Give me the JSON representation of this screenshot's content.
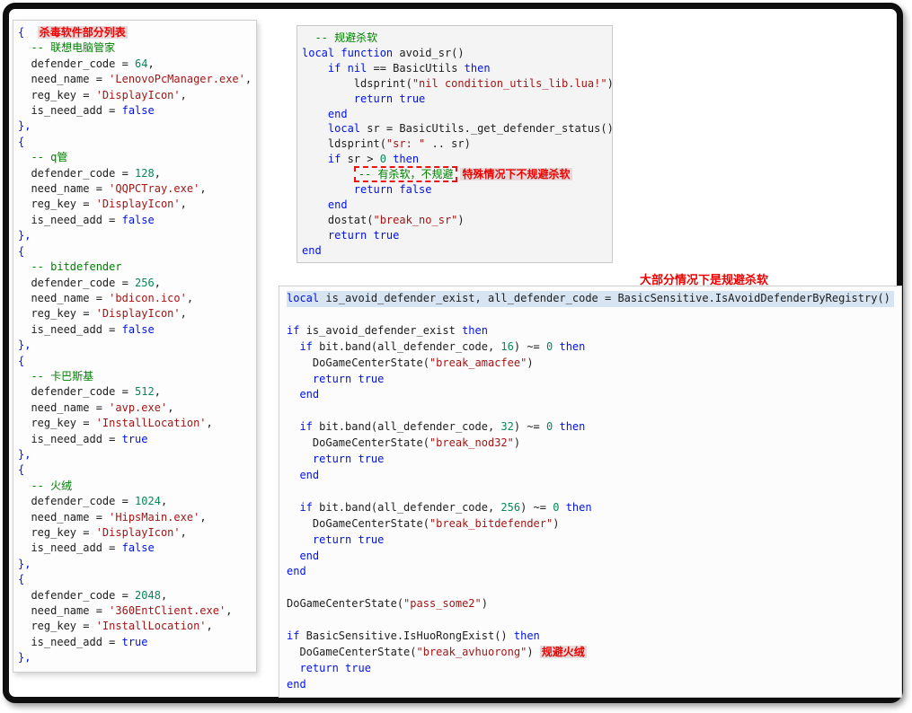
{
  "annotations": {
    "mid_note": "大部分情况下是规避杀软"
  },
  "panels": {
    "left": {
      "sel_lines": [],
      "lines": [
        [
          [
            "k",
            "{"
          ],
          [
            "p",
            "  "
          ],
          [
            "ah",
            "杀毒软件部分列表"
          ]
        ],
        [
          [
            "c",
            "  -- 联想电脑管家"
          ]
        ],
        [
          [
            "p",
            "  defender_code = "
          ],
          [
            "n",
            "64"
          ],
          [
            "p",
            ","
          ]
        ],
        [
          [
            "p",
            "  need_name = "
          ],
          [
            "s",
            "'LenovoPcManager.exe'"
          ],
          [
            "p",
            ","
          ]
        ],
        [
          [
            "p",
            "  reg_key = "
          ],
          [
            "s",
            "'DisplayIcon'"
          ],
          [
            "p",
            ","
          ]
        ],
        [
          [
            "p",
            "  is_need_add = "
          ],
          [
            "k",
            "false"
          ]
        ],
        [
          [
            "k",
            "},"
          ]
        ],
        [
          [
            "k",
            "{"
          ]
        ],
        [
          [
            "c",
            "  -- q管"
          ]
        ],
        [
          [
            "p",
            "  defender_code = "
          ],
          [
            "n",
            "128"
          ],
          [
            "p",
            ","
          ]
        ],
        [
          [
            "p",
            "  need_name = "
          ],
          [
            "s",
            "'QQPCTray.exe'"
          ],
          [
            "p",
            ","
          ]
        ],
        [
          [
            "p",
            "  reg_key = "
          ],
          [
            "s",
            "'DisplayIcon'"
          ],
          [
            "p",
            ","
          ]
        ],
        [
          [
            "p",
            "  is_need_add = "
          ],
          [
            "k",
            "false"
          ]
        ],
        [
          [
            "k",
            "},"
          ]
        ],
        [
          [
            "k",
            "{"
          ]
        ],
        [
          [
            "c",
            "  -- bitdefender"
          ]
        ],
        [
          [
            "p",
            "  defender_code = "
          ],
          [
            "n",
            "256"
          ],
          [
            "p",
            ","
          ]
        ],
        [
          [
            "p",
            "  need_name = "
          ],
          [
            "s",
            "'bdicon.ico'"
          ],
          [
            "p",
            ","
          ]
        ],
        [
          [
            "p",
            "  reg_key = "
          ],
          [
            "s",
            "'DisplayIcon'"
          ],
          [
            "p",
            ","
          ]
        ],
        [
          [
            "p",
            "  is_need_add = "
          ],
          [
            "k",
            "false"
          ]
        ],
        [
          [
            "k",
            "},"
          ]
        ],
        [
          [
            "k",
            "{"
          ]
        ],
        [
          [
            "c",
            "  -- 卡巴斯基"
          ]
        ],
        [
          [
            "p",
            "  defender_code = "
          ],
          [
            "n",
            "512"
          ],
          [
            "p",
            ","
          ]
        ],
        [
          [
            "p",
            "  need_name = "
          ],
          [
            "s",
            "'avp.exe'"
          ],
          [
            "p",
            ","
          ]
        ],
        [
          [
            "p",
            "  reg_key = "
          ],
          [
            "s",
            "'InstallLocation'"
          ],
          [
            "p",
            ","
          ]
        ],
        [
          [
            "p",
            "  is_need_add = "
          ],
          [
            "k",
            "true"
          ]
        ],
        [
          [
            "k",
            "},"
          ]
        ],
        [
          [
            "k",
            "{"
          ]
        ],
        [
          [
            "c",
            "  -- 火绒"
          ]
        ],
        [
          [
            "p",
            "  defender_code = "
          ],
          [
            "n",
            "1024"
          ],
          [
            "p",
            ","
          ]
        ],
        [
          [
            "p",
            "  need_name = "
          ],
          [
            "s",
            "'HipsMain.exe'"
          ],
          [
            "p",
            ","
          ]
        ],
        [
          [
            "p",
            "  reg_key = "
          ],
          [
            "s",
            "'DisplayIcon'"
          ],
          [
            "p",
            ","
          ]
        ],
        [
          [
            "p",
            "  is_need_add = "
          ],
          [
            "k",
            "false"
          ]
        ],
        [
          [
            "k",
            "},"
          ]
        ],
        [
          [
            "k",
            "{"
          ]
        ],
        [
          [
            "p",
            "  defender_code = "
          ],
          [
            "n",
            "2048"
          ],
          [
            "p",
            ","
          ]
        ],
        [
          [
            "p",
            "  need_name = "
          ],
          [
            "s",
            "'360EntClient.exe'"
          ],
          [
            "p",
            ","
          ]
        ],
        [
          [
            "p",
            "  reg_key = "
          ],
          [
            "s",
            "'InstallLocation'"
          ],
          [
            "p",
            ","
          ]
        ],
        [
          [
            "p",
            "  is_need_add = "
          ],
          [
            "k",
            "true"
          ]
        ],
        [
          [
            "k",
            "},"
          ]
        ]
      ]
    },
    "top_right": {
      "sel_lines": [],
      "lines": [
        [
          [
            "c",
            "  -- 规避杀软"
          ]
        ],
        [
          [
            "k",
            "local function"
          ],
          [
            "p",
            " avoid_sr()"
          ]
        ],
        [
          [
            "p",
            "    "
          ],
          [
            "k",
            "if"
          ],
          [
            "p",
            " "
          ],
          [
            "k",
            "nil"
          ],
          [
            "p",
            " == BasicUtils "
          ],
          [
            "k",
            "then"
          ]
        ],
        [
          [
            "p",
            "        ldsprint("
          ],
          [
            "s",
            "\"nil condition_utils_lib.lua!\""
          ],
          [
            "p",
            ")"
          ]
        ],
        [
          [
            "p",
            "        "
          ],
          [
            "k",
            "return true"
          ]
        ],
        [
          [
            "p",
            "    "
          ],
          [
            "k",
            "end"
          ]
        ],
        [
          [
            "p",
            "    "
          ],
          [
            "k",
            "local"
          ],
          [
            "p",
            " sr = BasicUtils._get_defender_status()"
          ]
        ],
        [
          [
            "p",
            "    ldsprint("
          ],
          [
            "s",
            "\"sr: \""
          ],
          [
            "p",
            " .. sr)"
          ]
        ],
        [
          [
            "p",
            "    "
          ],
          [
            "k",
            "if"
          ],
          [
            "p",
            " sr > "
          ],
          [
            "n",
            "0"
          ],
          [
            "p",
            " "
          ],
          [
            "k",
            "then"
          ]
        ],
        [
          [
            "p",
            "        "
          ],
          [
            "bx",
            "-- 有杀软，不规避"
          ],
          [
            "ah",
            "特殊情况下不规避杀软"
          ]
        ],
        [
          [
            "p",
            "        "
          ],
          [
            "k",
            "return false"
          ]
        ],
        [
          [
            "p",
            "    "
          ],
          [
            "k",
            "end"
          ]
        ],
        [
          [
            "p",
            "    dostat("
          ],
          [
            "s",
            "\"break_no_sr\""
          ],
          [
            "p",
            ")"
          ]
        ],
        [
          [
            "p",
            "    "
          ],
          [
            "k",
            "return true"
          ]
        ],
        [
          [
            "k",
            "end"
          ]
        ]
      ]
    },
    "bottom_right": {
      "sel_lines": [
        0
      ],
      "lines": [
        [
          [
            "k",
            "local"
          ],
          [
            "p",
            " is_avoid_defender_exist, all_defender_code = BasicSensitive.IsAvoidDefenderByRegistry()"
          ]
        ],
        [],
        [
          [
            "k",
            "if"
          ],
          [
            "p",
            " is_avoid_defender_exist "
          ],
          [
            "k",
            "then"
          ]
        ],
        [
          [
            "p",
            "  "
          ],
          [
            "k",
            "if"
          ],
          [
            "p",
            " bit.band(all_defender_code, "
          ],
          [
            "n",
            "16"
          ],
          [
            "p",
            ") ~= "
          ],
          [
            "n",
            "0"
          ],
          [
            "p",
            " "
          ],
          [
            "k",
            "then"
          ]
        ],
        [
          [
            "p",
            "    DoGameCenterState("
          ],
          [
            "s",
            "\"break_amacfee\""
          ],
          [
            "p",
            ")"
          ]
        ],
        [
          [
            "p",
            "    "
          ],
          [
            "k",
            "return true"
          ]
        ],
        [
          [
            "p",
            "  "
          ],
          [
            "k",
            "end"
          ]
        ],
        [],
        [
          [
            "p",
            "  "
          ],
          [
            "k",
            "if"
          ],
          [
            "p",
            " bit.band(all_defender_code, "
          ],
          [
            "n",
            "32"
          ],
          [
            "p",
            ") ~= "
          ],
          [
            "n",
            "0"
          ],
          [
            "p",
            " "
          ],
          [
            "k",
            "then"
          ]
        ],
        [
          [
            "p",
            "    DoGameCenterState("
          ],
          [
            "s",
            "\"break_nod32\""
          ],
          [
            "p",
            ")"
          ]
        ],
        [
          [
            "p",
            "    "
          ],
          [
            "k",
            "return true"
          ]
        ],
        [
          [
            "p",
            "  "
          ],
          [
            "k",
            "end"
          ]
        ],
        [],
        [
          [
            "p",
            "  "
          ],
          [
            "k",
            "if"
          ],
          [
            "p",
            " bit.band(all_defender_code, "
          ],
          [
            "n",
            "256"
          ],
          [
            "p",
            ") ~= "
          ],
          [
            "n",
            "0"
          ],
          [
            "p",
            " "
          ],
          [
            "k",
            "then"
          ]
        ],
        [
          [
            "p",
            "    DoGameCenterState("
          ],
          [
            "s",
            "\"break_bitdefender\""
          ],
          [
            "p",
            ")"
          ]
        ],
        [
          [
            "p",
            "    "
          ],
          [
            "k",
            "return true"
          ]
        ],
        [
          [
            "p",
            "  "
          ],
          [
            "k",
            "end"
          ]
        ],
        [
          [
            "k",
            "end"
          ]
        ],
        [],
        [
          [
            "p",
            "DoGameCenterState("
          ],
          [
            "s",
            "\"pass_some2\""
          ],
          [
            "p",
            ")"
          ]
        ],
        [],
        [
          [
            "k",
            "if"
          ],
          [
            "p",
            " BasicSensitive.IsHuoRongExist() "
          ],
          [
            "k",
            "then"
          ]
        ],
        [
          [
            "p",
            "  DoGameCenterState("
          ],
          [
            "s",
            "\"break_avhuorong\""
          ],
          [
            "p",
            ") "
          ],
          [
            "ah",
            "规避火绒"
          ]
        ],
        [
          [
            "p",
            "  "
          ],
          [
            "k",
            "return true"
          ]
        ],
        [
          [
            "k",
            "end"
          ]
        ]
      ]
    }
  }
}
